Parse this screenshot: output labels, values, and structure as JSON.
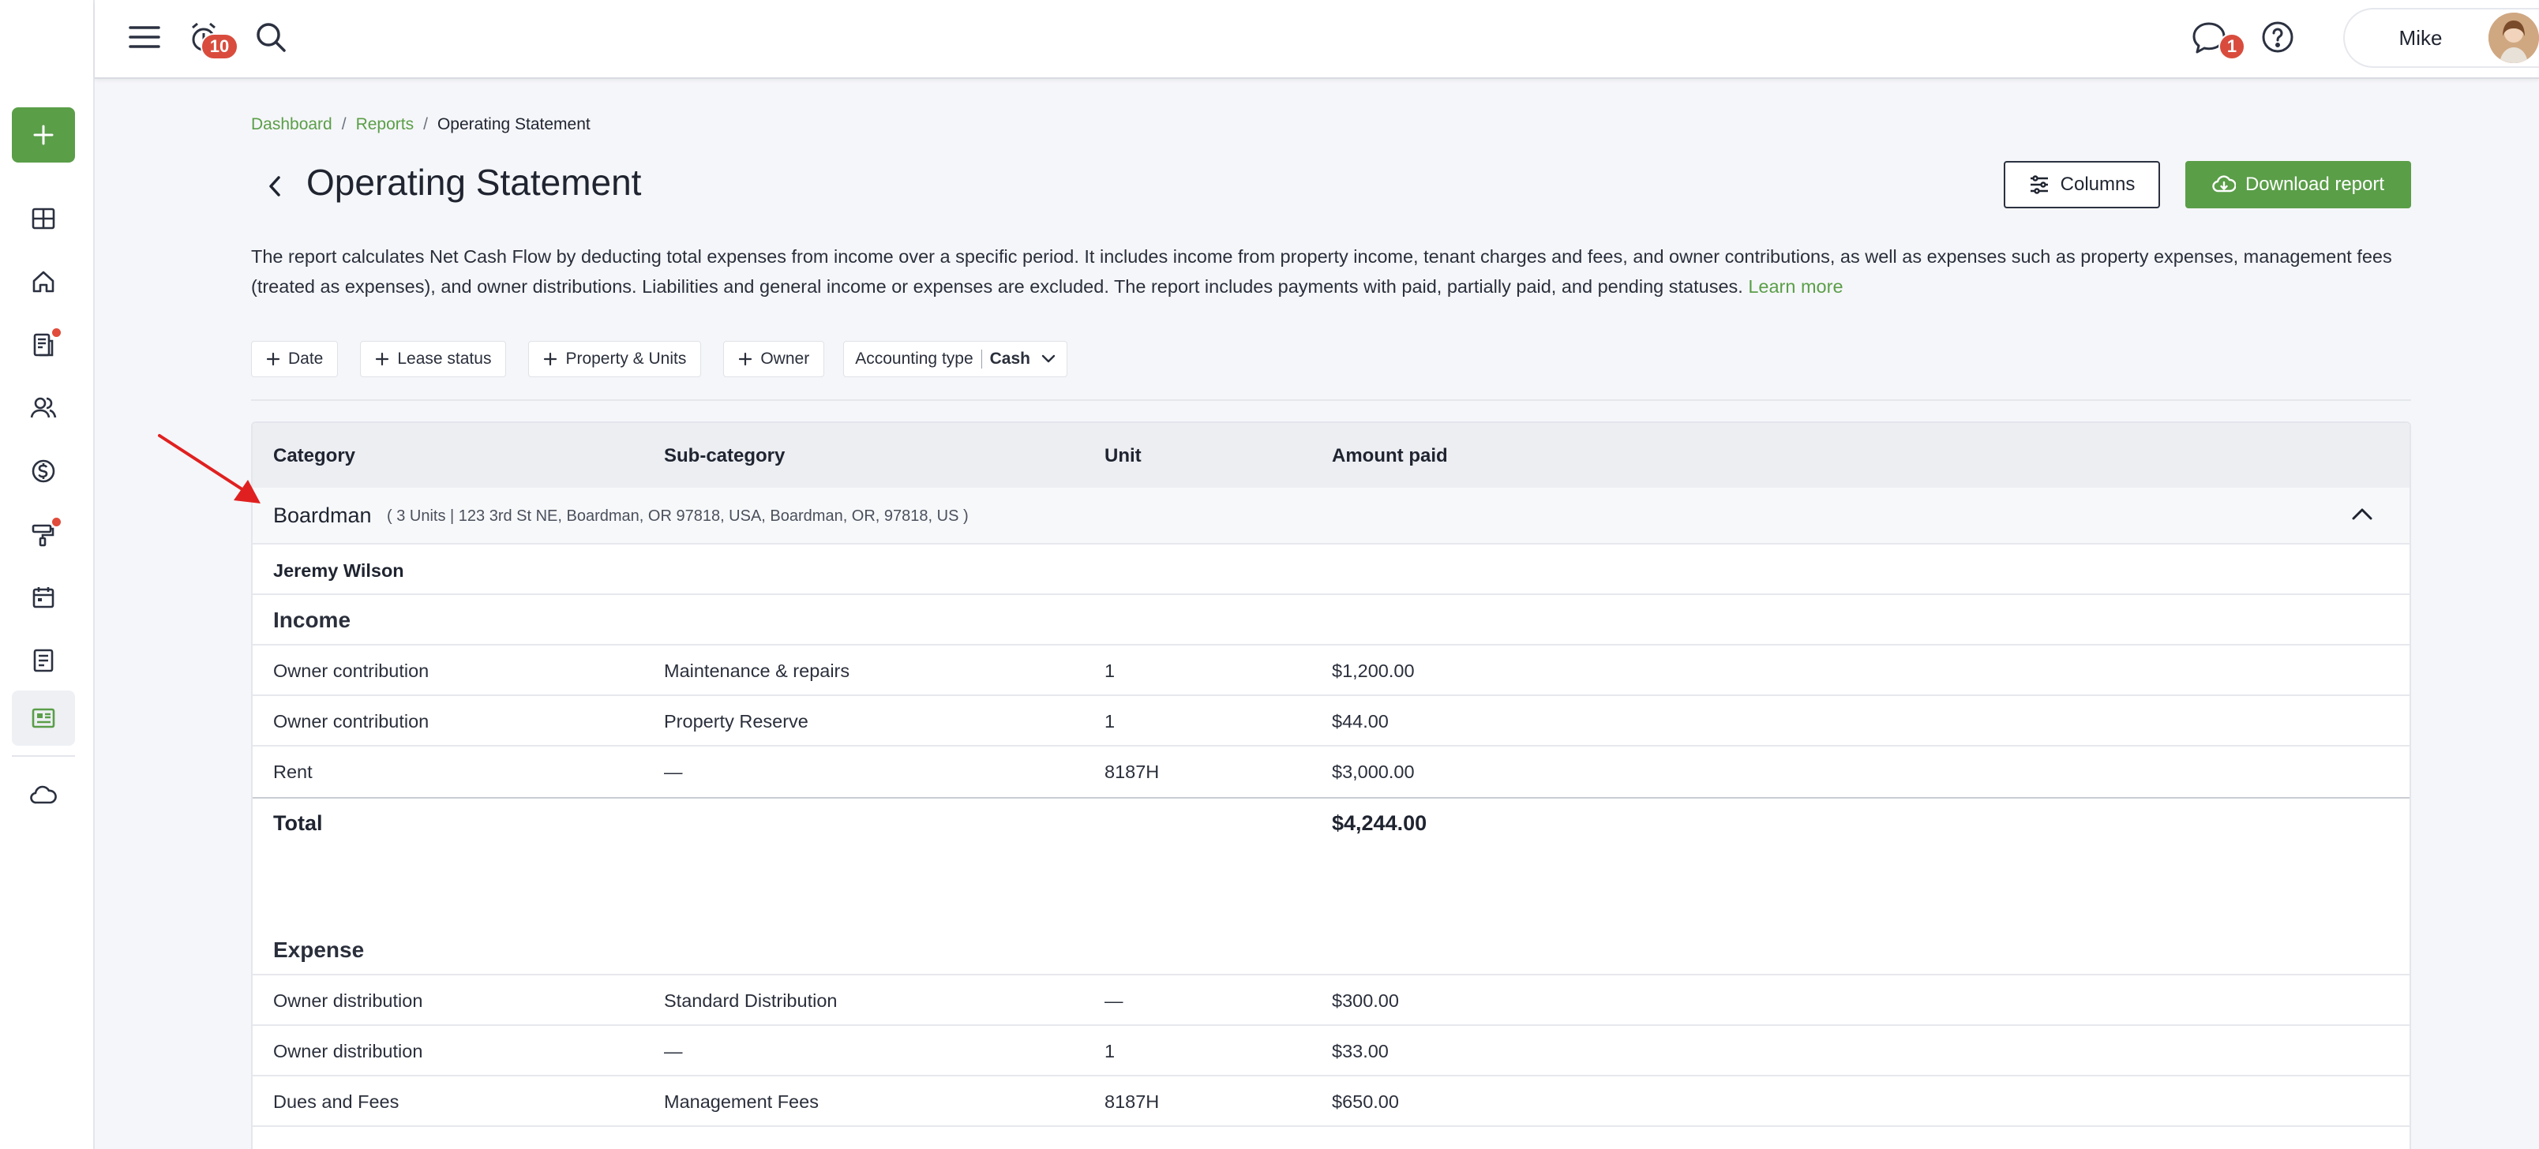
{
  "topbar": {
    "notifications_count": "10",
    "messages_count": "1",
    "user_name": "Mike"
  },
  "sidebar": {
    "items": [
      {
        "icon": "dashboard-icon"
      },
      {
        "icon": "home-icon"
      },
      {
        "icon": "leases-icon",
        "dot": true
      },
      {
        "icon": "people-icon"
      },
      {
        "icon": "dollar-icon"
      },
      {
        "icon": "maintenance-icon",
        "dot": true
      },
      {
        "icon": "calendar-icon"
      },
      {
        "icon": "document-icon"
      },
      {
        "icon": "reports-icon",
        "active": true
      },
      {
        "icon": "cloud-icon"
      }
    ]
  },
  "breadcrumb": {
    "items": [
      "Dashboard",
      "Reports"
    ],
    "current": "Operating Statement",
    "separator": "/"
  },
  "page": {
    "title": "Operating Statement",
    "columns_label": "Columns",
    "download_label": "Download report",
    "description": "The report calculates Net Cash Flow by deducting total expenses from income over a specific period. It includes income from property income, tenant charges and fees, and owner contributions, as well as expenses such as property expenses, management fees (treated as expenses), and owner distributions. Liabilities and general income or expenses are excluded. The report includes payments with paid, partially paid, and pending statuses.",
    "learn_more": "Learn more"
  },
  "filters": {
    "chips": [
      "Date",
      "Lease status",
      "Property & Units",
      "Owner"
    ],
    "accounting_label": "Accounting type",
    "accounting_value": "Cash"
  },
  "table": {
    "headers": {
      "category": "Category",
      "subcategory": "Sub-category",
      "unit": "Unit",
      "amount": "Amount paid"
    },
    "group": {
      "name": "Boardman",
      "address": "( 3 Units | 123 3rd St NE, Boardman, OR 97818, USA, Boardman, OR, 97818, US )"
    },
    "owner": "Jeremy Wilson",
    "income": {
      "title": "Income",
      "rows": [
        {
          "category": "Owner contribution",
          "subcategory": "Maintenance & repairs",
          "unit": "1",
          "amount": "$1,200.00"
        },
        {
          "category": "Owner contribution",
          "subcategory": "Property Reserve",
          "unit": "1",
          "amount": "$44.00"
        },
        {
          "category": "Rent",
          "subcategory": "—",
          "unit": "8187H",
          "amount": "$3,000.00"
        }
      ],
      "total_label": "Total",
      "total_amount": "$4,244.00"
    },
    "expense": {
      "title": "Expense",
      "rows": [
        {
          "category": "Owner distribution",
          "subcategory": "Standard Distribution",
          "unit": "—",
          "amount": "$300.00"
        },
        {
          "category": "Owner distribution",
          "subcategory": "—",
          "unit": "1",
          "amount": "$33.00"
        },
        {
          "category": "Dues and Fees",
          "subcategory": "Management Fees",
          "unit": "8187H",
          "amount": "$650.00"
        }
      ]
    }
  },
  "colors": {
    "accent": "#5a9e48",
    "badge": "#d94c3d",
    "annotation": "#e02020"
  }
}
